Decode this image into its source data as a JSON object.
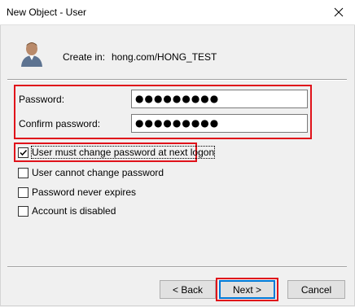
{
  "window": {
    "title": "New Object - User"
  },
  "header": {
    "create_in_label": "Create in:",
    "create_in_value": "hong.com/HONG_TEST"
  },
  "password": {
    "label": "Password:",
    "value": "●●●●●●●●●",
    "confirm_label": "Confirm password:",
    "confirm_value": "●●●●●●●●●"
  },
  "options": [
    {
      "label": "User must change password at next logon",
      "checked": true
    },
    {
      "label": "User cannot change password",
      "checked": false
    },
    {
      "label": "Password never expires",
      "checked": false
    },
    {
      "label": "Account is disabled",
      "checked": false
    }
  ],
  "buttons": {
    "back": "< Back",
    "next": "Next >",
    "cancel": "Cancel"
  },
  "colors": {
    "highlight": "#e0121a",
    "focus": "#0078d7"
  }
}
